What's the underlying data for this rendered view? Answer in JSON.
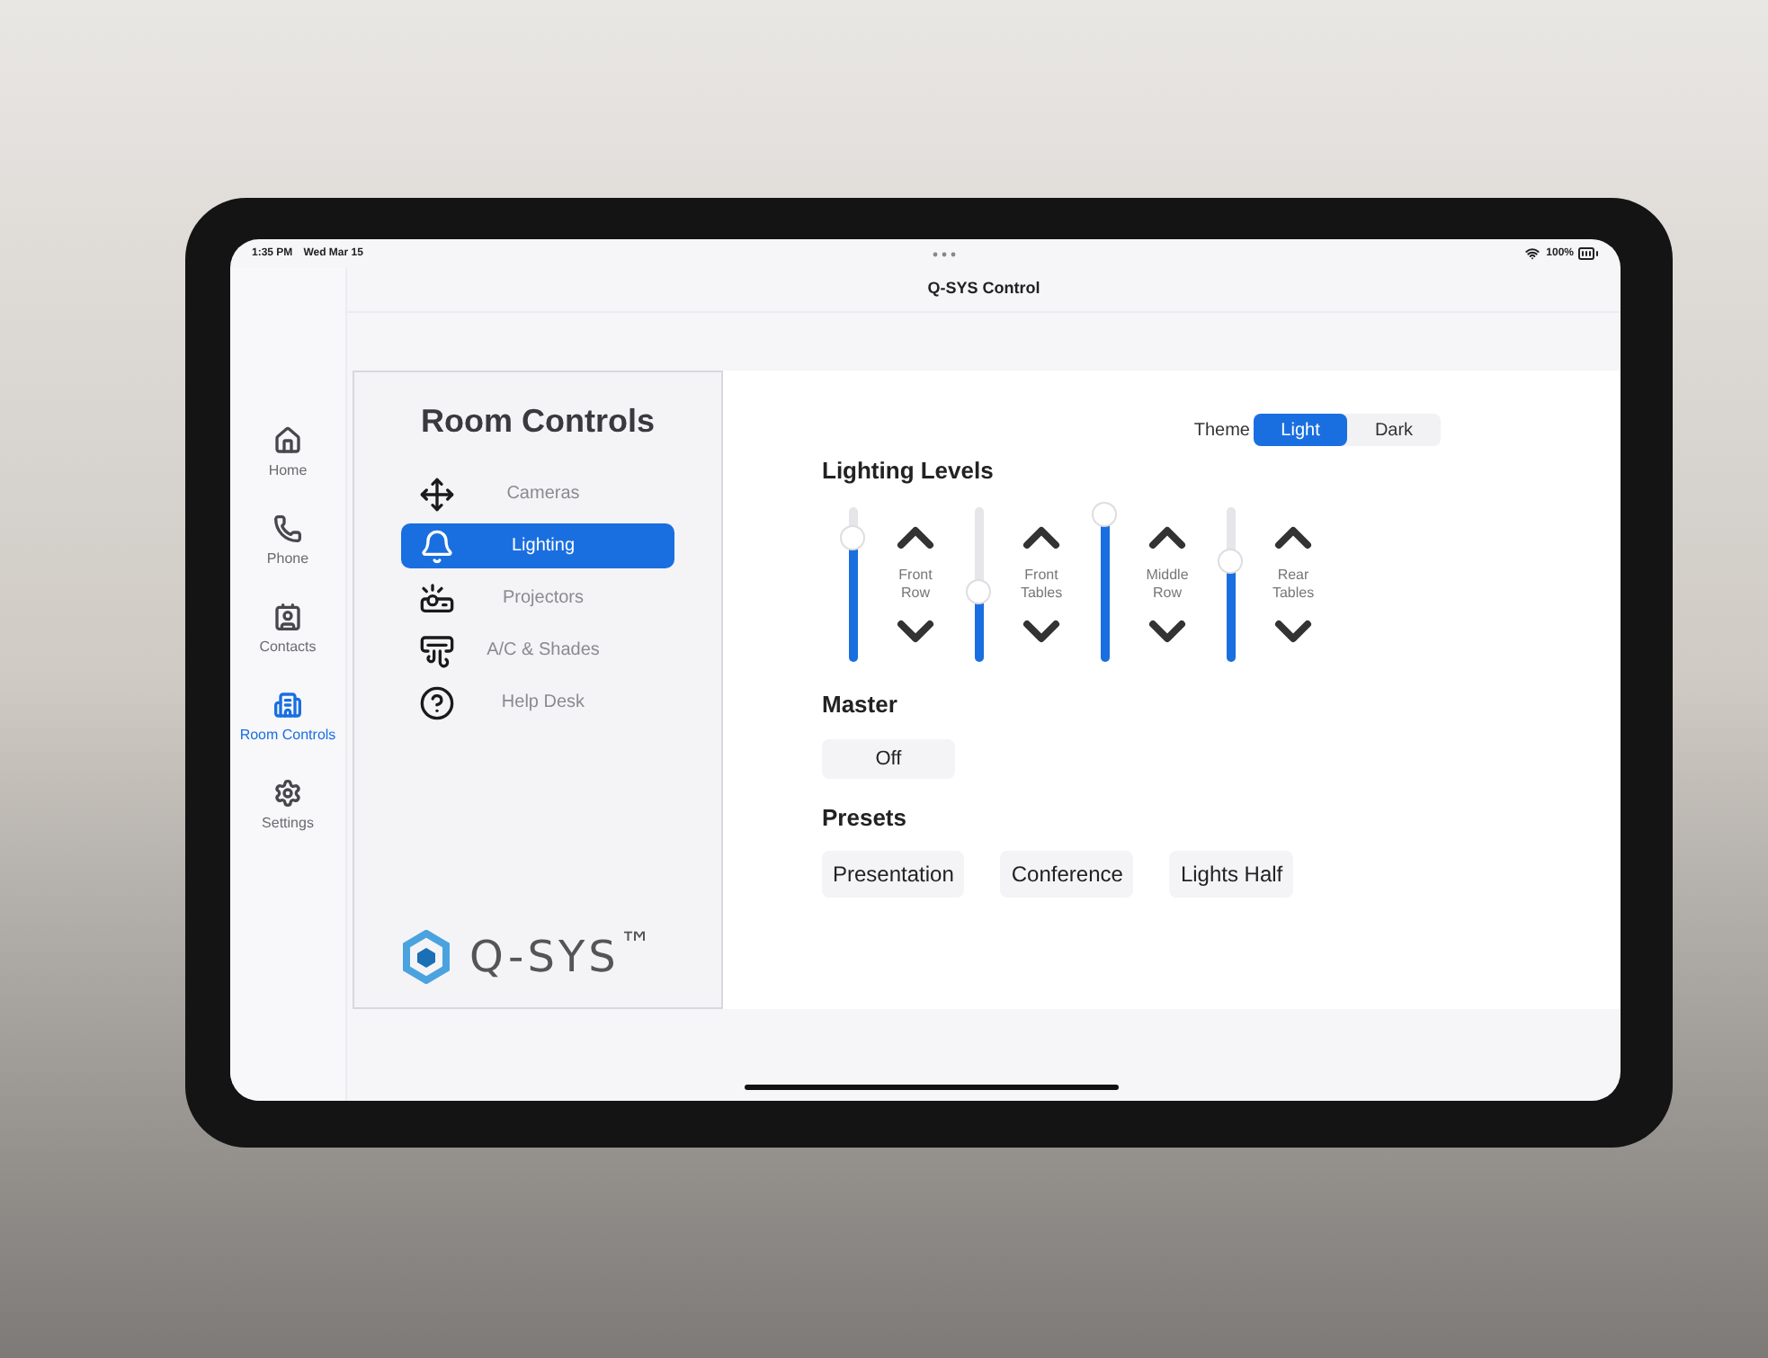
{
  "status_bar": {
    "time": "1:35 PM",
    "date": "Wed Mar 15",
    "battery": "100%"
  },
  "title": "Q-SYS Control",
  "tab_bar": [
    {
      "label": "Home",
      "selected": false
    },
    {
      "label": "Phone",
      "selected": false
    },
    {
      "label": "Contacts",
      "selected": false
    },
    {
      "label": "Room Controls",
      "selected": true
    },
    {
      "label": "Settings",
      "selected": false
    }
  ],
  "room_menu": {
    "title": "Room Controls",
    "items": [
      {
        "label": "Cameras",
        "selected": false
      },
      {
        "label": "Lighting",
        "selected": true
      },
      {
        "label": "Projectors",
        "selected": false
      },
      {
        "label": "A/C & Shades",
        "selected": false
      },
      {
        "label": "Help Desk",
        "selected": false
      }
    ],
    "logo": "Q-SYS$^{™}$"
  },
  "theme": {
    "label": "Theme",
    "options": [
      {
        "label": "Light",
        "selected": true
      },
      {
        "label": "Dark",
        "selected": false
      }
    ]
  },
  "lighting": {
    "title": "Lighting Levels",
    "zones": [
      {
        "name": "Front Row",
        "level": 0.8
      },
      {
        "name": "Front Tables",
        "level": 0.45
      },
      {
        "name": "Middle Row",
        "level": 0.95
      },
      {
        "name": "Rear Tables",
        "level": 0.65
      }
    ]
  },
  "master": {
    "title": "Master",
    "button": "Off"
  },
  "presets": {
    "title": "Presets",
    "buttons": [
      "Presentation",
      "Conference",
      "Lights Half"
    ]
  }
}
